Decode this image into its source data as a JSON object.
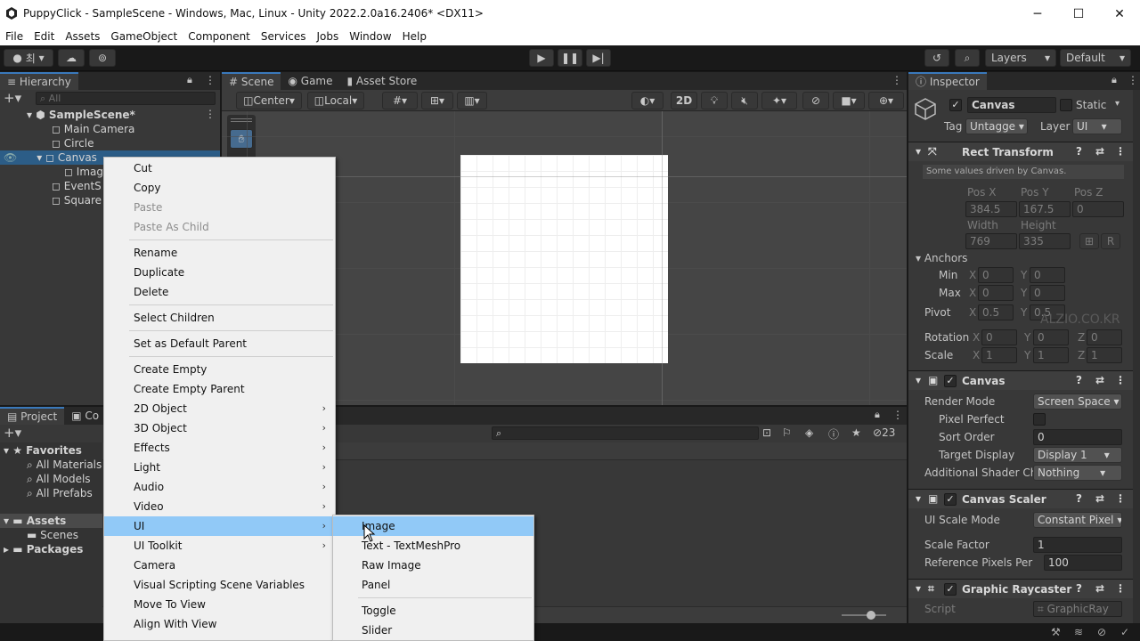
{
  "window": {
    "title": "PuppyClick - SampleScene - Windows, Mac, Linux - Unity 2022.2.0a16.2406* <DX11>",
    "minimize": "─",
    "maximize": "☐",
    "close": "✕"
  },
  "menu": [
    "File",
    "Edit",
    "Assets",
    "GameObject",
    "Component",
    "Services",
    "Jobs",
    "Window",
    "Help"
  ],
  "toolbar": {
    "account_label": "최",
    "layers_label": "Layers",
    "layout_label": "Default"
  },
  "hierarchy": {
    "tab": "Hierarchy",
    "search_placeholder": "All",
    "scene": "SampleScene*",
    "items": [
      "Main Camera",
      "Circle",
      "Canvas",
      "Image",
      "EventS",
      "Square"
    ]
  },
  "scene_view": {
    "tabs": [
      "Scene",
      "Game",
      "Asset Store"
    ],
    "pivot": "Center",
    "space": "Local",
    "mode_2d": "2D"
  },
  "project": {
    "tabs": [
      "Project",
      "Co"
    ],
    "favorites_label": "Favorites",
    "favorites": [
      "All Materials",
      "All Models",
      "All Prefabs"
    ],
    "assets_label": "Assets",
    "assets": [
      "Scenes"
    ],
    "packages_label": "Packages",
    "hidden_count": "23"
  },
  "context_menu": {
    "items": [
      {
        "label": "Cut",
        "disabled": false,
        "submenu": false
      },
      {
        "label": "Copy",
        "disabled": false,
        "submenu": false
      },
      {
        "label": "Paste",
        "disabled": true,
        "submenu": false
      },
      {
        "label": "Paste As Child",
        "disabled": true,
        "submenu": false
      },
      {
        "label": "Rename",
        "disabled": false,
        "submenu": false
      },
      {
        "label": "Duplicate",
        "disabled": false,
        "submenu": false
      },
      {
        "label": "Delete",
        "disabled": false,
        "submenu": false
      },
      {
        "label": "Select Children",
        "disabled": false,
        "submenu": false
      },
      {
        "label": "Set as Default Parent",
        "disabled": false,
        "submenu": false
      },
      {
        "label": "Create Empty",
        "disabled": false,
        "submenu": false
      },
      {
        "label": "Create Empty Parent",
        "disabled": false,
        "submenu": false
      },
      {
        "label": "2D Object",
        "disabled": false,
        "submenu": true
      },
      {
        "label": "3D Object",
        "disabled": false,
        "submenu": true
      },
      {
        "label": "Effects",
        "disabled": false,
        "submenu": true
      },
      {
        "label": "Light",
        "disabled": false,
        "submenu": true
      },
      {
        "label": "Audio",
        "disabled": false,
        "submenu": true
      },
      {
        "label": "Video",
        "disabled": false,
        "submenu": true
      },
      {
        "label": "UI",
        "disabled": false,
        "submenu": true,
        "highlighted": true
      },
      {
        "label": "UI Toolkit",
        "disabled": false,
        "submenu": true
      },
      {
        "label": "Camera",
        "disabled": false,
        "submenu": false
      },
      {
        "label": "Visual Scripting Scene Variables",
        "disabled": false,
        "submenu": false
      },
      {
        "label": "Move To View",
        "disabled": false,
        "submenu": false
      },
      {
        "label": "Align With View",
        "disabled": false,
        "submenu": false
      }
    ],
    "submenu_ui": [
      "Image",
      "Text - TextMeshPro",
      "Raw Image",
      "Panel",
      "Toggle",
      "Slider"
    ]
  },
  "inspector": {
    "tab": "Inspector",
    "object_name": "Canvas",
    "static_label": "Static",
    "tag_label": "Tag",
    "tag_value": "Untagge",
    "layer_label": "Layer",
    "layer_value": "UI",
    "rect_transform": {
      "title": "Rect Transform",
      "note": "Some values driven by Canvas.",
      "pos_x_label": "Pos X",
      "pos_y_label": "Pos Y",
      "pos_z_label": "Pos Z",
      "pos_x": "384.5",
      "pos_y": "167.5",
      "pos_z": "0",
      "width_label": "Width",
      "height_label": "Height",
      "width": "769",
      "height": "335",
      "anchors_label": "Anchors",
      "min_label": "Min",
      "max_label": "Max",
      "min_x": "0",
      "min_y": "0",
      "max_x": "0",
      "max_y": "0",
      "pivot_label": "Pivot",
      "pivot_x": "0.5",
      "pivot_y": "0.5",
      "rotation_label": "Rotation",
      "rot_x": "0",
      "rot_y": "0",
      "rot_z": "0",
      "scale_label": "Scale",
      "scale_x": "1",
      "scale_y": "1",
      "scale_z": "1",
      "r_button": "R"
    },
    "canvas": {
      "title": "Canvas",
      "render_mode_label": "Render Mode",
      "render_mode": "Screen Space",
      "pixel_perfect_label": "Pixel Perfect",
      "sort_order_label": "Sort Order",
      "sort_order": "0",
      "target_display_label": "Target Display",
      "target_display": "Display 1",
      "shader_label": "Additional Shader Ch",
      "shader_value": "Nothing"
    },
    "canvas_scaler": {
      "title": "Canvas Scaler",
      "scale_mode_label": "UI Scale Mode",
      "scale_mode": "Constant Pixel",
      "scale_factor_label": "Scale Factor",
      "scale_factor": "1",
      "ref_pixels_label": "Reference Pixels Per",
      "ref_pixels": "100"
    },
    "graphic_raycaster": {
      "title": "Graphic Raycaster",
      "script_label": "Script",
      "script_value": "GraphicRay"
    }
  },
  "watermark": "ALZIO.CO.KR",
  "xyz": {
    "x": "X",
    "y": "Y",
    "z": "Z"
  }
}
